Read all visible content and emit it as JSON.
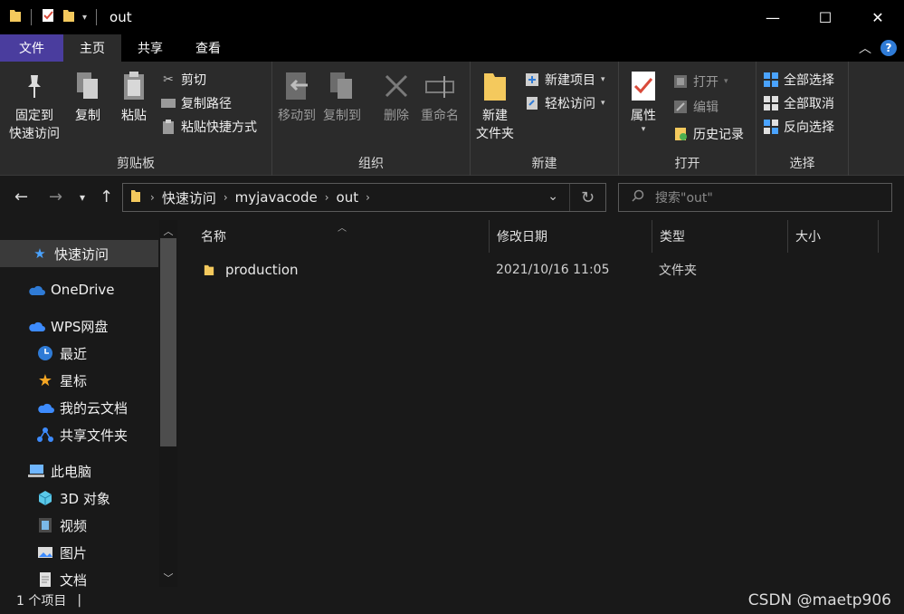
{
  "window": {
    "title": "out",
    "controls": {
      "minimize": "—",
      "maximize": "☐",
      "close": "✕"
    }
  },
  "ribbon_tabs": [
    "文件",
    "主页",
    "共享",
    "查看"
  ],
  "ribbon": {
    "clipboard": {
      "label": "剪贴板",
      "pin": [
        "固定到",
        "快速访问"
      ],
      "copy": "复制",
      "paste": "粘贴",
      "cut": "剪切",
      "copy_path": "复制路径",
      "paste_shortcut": "粘贴快捷方式"
    },
    "organize": {
      "label": "组织",
      "move_to": "移动到",
      "copy_to": "复制到",
      "delete": "删除",
      "rename": "重命名"
    },
    "new": {
      "label": "新建",
      "new_folder": [
        "新建",
        "文件夹"
      ],
      "new_item": "新建项目",
      "easy_access": "轻松访问"
    },
    "open": {
      "label": "打开",
      "properties": "属性",
      "open": "打开",
      "edit": "编辑",
      "history": "历史记录"
    },
    "select": {
      "label": "选择",
      "select_all": "全部选择",
      "select_none": "全部取消",
      "invert": "反向选择"
    }
  },
  "address": {
    "crumbs": [
      "快速访问",
      "myjavacode",
      "out"
    ],
    "search_placeholder": "搜索\"out\""
  },
  "sidebar": {
    "items": [
      {
        "label": "快速访问"
      },
      {
        "label": "OneDrive"
      },
      {
        "label": "WPS网盘"
      },
      {
        "label": "最近"
      },
      {
        "label": "星标"
      },
      {
        "label": "我的云文档"
      },
      {
        "label": "共享文件夹"
      },
      {
        "label": "此电脑"
      },
      {
        "label": "3D 对象"
      },
      {
        "label": "视频"
      },
      {
        "label": "图片"
      },
      {
        "label": "文档"
      }
    ]
  },
  "columns": [
    "名称",
    "修改日期",
    "类型",
    "大小"
  ],
  "files": [
    {
      "name": "production",
      "modified": "2021/10/16 11:05",
      "type": "文件夹",
      "size": ""
    }
  ],
  "status": {
    "count": "1 个项目",
    "sep": "|"
  },
  "watermark": "CSDN @maetp906",
  "colors": {
    "file_tab": "#4a3d9e",
    "folder": "#f4c95d",
    "accent_blue": "#2f7bd6"
  }
}
